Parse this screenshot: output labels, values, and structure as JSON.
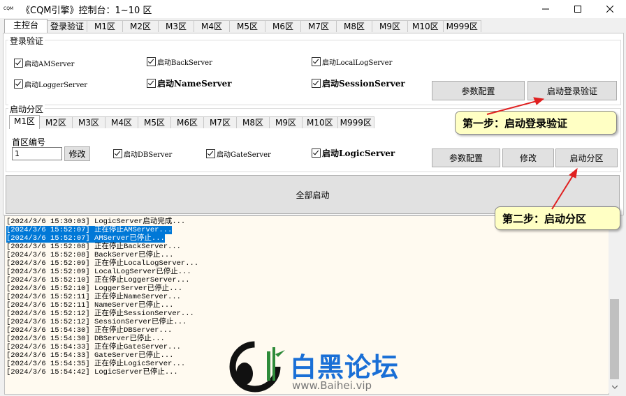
{
  "window": {
    "icon_label": "CQM",
    "title": "《CQM引擎》控制台：1~10 区"
  },
  "main_tabs": [
    "主控台",
    "登录验证",
    "M1区",
    "M2区",
    "M3区",
    "M4区",
    "M5区",
    "M6区",
    "M7区",
    "M8区",
    "M9区",
    "M10区",
    "M999区"
  ],
  "login_group": {
    "title": "登录验证",
    "checks": [
      "启动AMServer",
      "启动BackServer",
      "启动LocalLogServer",
      "启动LoggerServer",
      "启动NameServer",
      "启动SessionServer"
    ],
    "params_button": "参数配置",
    "start_button": "启动登录验证"
  },
  "zone_group": {
    "title": "启动分区",
    "tabs": [
      "M1区",
      "M2区",
      "M3区",
      "M4区",
      "M5区",
      "M6区",
      "M7区",
      "M8区",
      "M9区",
      "M10区",
      "M999区"
    ],
    "zone_label": "首区编号",
    "zone_value": "1",
    "modify_small": "修改",
    "checks": [
      "启动DBServer",
      "启动GateServer",
      "启动LogicServer"
    ],
    "params_button": "参数配置",
    "modify_button": "修改",
    "start_button": "启动分区"
  },
  "start_all_button": "全部启动",
  "callouts": {
    "step1": "第一步：启动登录验证",
    "step2": "第二步：启动分区"
  },
  "log": [
    {
      "text": "[2024/3/6 15:30:03] LogicServer启动完成...",
      "selected": false
    },
    {
      "text": "[2024/3/6 15:52:07] 正在停止AMServer...",
      "selected": true
    },
    {
      "text": "[2024/3/6 15:52:07] AMServer已停止...",
      "selected": true
    },
    {
      "text": "[2024/3/6 15:52:08] 正在停止BackServer...",
      "selected": false
    },
    {
      "text": "[2024/3/6 15:52:08] BackServer已停止...",
      "selected": false
    },
    {
      "text": "[2024/3/6 15:52:09] 正在停止LocalLogServer...",
      "selected": false
    },
    {
      "text": "[2024/3/6 15:52:09] LocalLogServer已停止...",
      "selected": false
    },
    {
      "text": "[2024/3/6 15:52:10] 正在停止LoggerServer...",
      "selected": false
    },
    {
      "text": "[2024/3/6 15:52:10] LoggerServer已停止...",
      "selected": false
    },
    {
      "text": "[2024/3/6 15:52:11] 正在停止NameServer...",
      "selected": false
    },
    {
      "text": "[2024/3/6 15:52:11] NameServer已停止...",
      "selected": false
    },
    {
      "text": "[2024/3/6 15:52:12] 正在停止SessionServer...",
      "selected": false
    },
    {
      "text": "[2024/3/6 15:52:12] SessionServer已停止...",
      "selected": false
    },
    {
      "text": "[2024/3/6 15:54:30] 正在停止DBServer...",
      "selected": false
    },
    {
      "text": "[2024/3/6 15:54:30] DBServer已停止...",
      "selected": false
    },
    {
      "text": "[2024/3/6 15:54:33] 正在停止GateServer...",
      "selected": false
    },
    {
      "text": "[2024/3/6 15:54:33] GateServer已停止...",
      "selected": false
    },
    {
      "text": "[2024/3/6 15:54:35] 正在停止LogicServer...",
      "selected": false
    },
    {
      "text": "[2024/3/6 15:54:42] LogicServer已停止...",
      "selected": false
    }
  ],
  "watermark": {
    "name": "白黑论坛",
    "url": "www.Baihei.vip"
  },
  "colors": {
    "selection": "#0078d7",
    "callout_bg": "#ffffc4",
    "arrow": "#e02020",
    "watermark_blue": "#1a6fd6"
  }
}
